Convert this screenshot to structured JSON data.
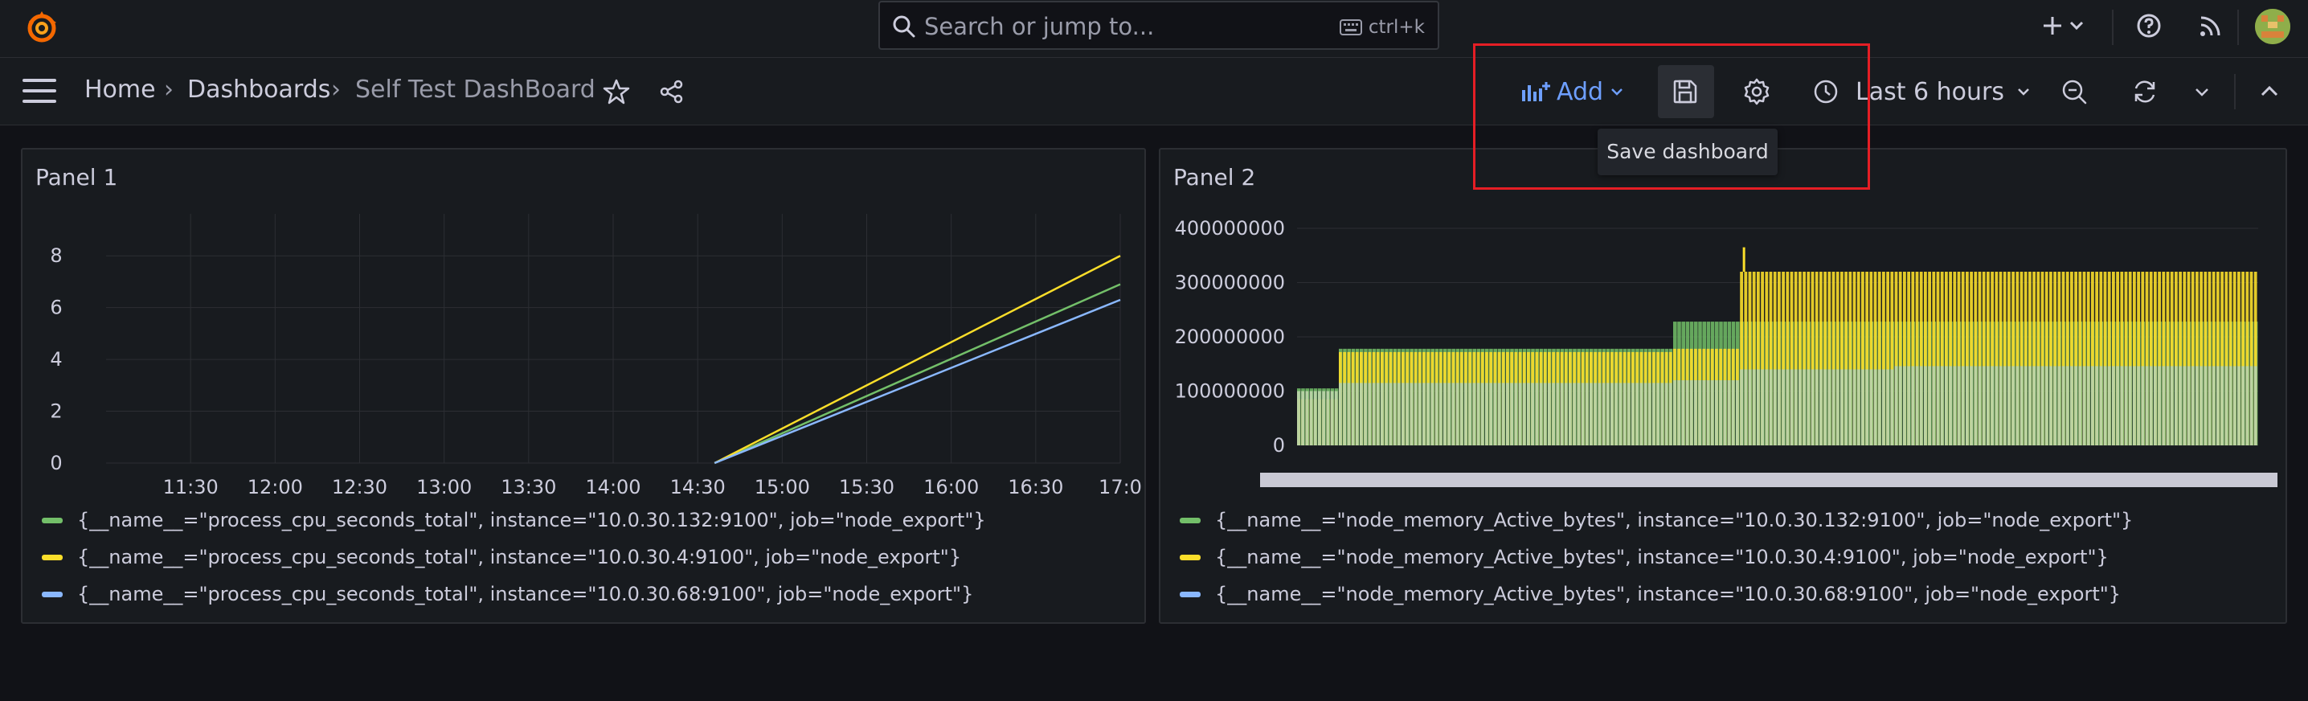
{
  "colors": {
    "series_green": "#73bf69",
    "series_yellow": "#fade2a",
    "series_blue": "#8ab8ff",
    "accent_blue": "#6e9fff",
    "highlight_red": "#e51e25"
  },
  "topbar": {
    "search_placeholder": "Search or jump to...",
    "search_shortcut": "ctrl+k",
    "icons": [
      "grafana-logo-icon",
      "search-icon",
      "keyboard-icon",
      "plus-icon",
      "chevron-down-icon",
      "help-icon",
      "rss-icon",
      "avatar"
    ]
  },
  "navbar": {
    "breadcrumb": [
      "Home",
      "Dashboards",
      "Self Test DashBoard"
    ],
    "separator": "›",
    "add_label": "Add",
    "time_range": "Last 6 hours",
    "tooltip": "Save dashboard"
  },
  "panel1": {
    "title": "Panel 1",
    "legend": [
      "{__name__=\"process_cpu_seconds_total\", instance=\"10.0.30.132:9100\", job=\"node_export\"}",
      "{__name__=\"process_cpu_seconds_total\", instance=\"10.0.30.4:9100\", job=\"node_export\"}",
      "{__name__=\"process_cpu_seconds_total\", instance=\"10.0.30.68:9100\", job=\"node_export\"}"
    ]
  },
  "panel2": {
    "title": "Panel 2",
    "legend": [
      "{__name__=\"node_memory_Active_bytes\", instance=\"10.0.30.132:9100\", job=\"node_export\"}",
      "{__name__=\"node_memory_Active_bytes\", instance=\"10.0.30.4:9100\", job=\"node_export\"}",
      "{__name__=\"node_memory_Active_bytes\", instance=\"10.0.30.68:9100\", job=\"node_export\"}"
    ]
  },
  "chart_data": [
    {
      "type": "line",
      "x_ticks": [
        "11:30",
        "12:00",
        "12:30",
        "13:00",
        "13:30",
        "14:00",
        "14:30",
        "15:00",
        "15:30",
        "16:00",
        "16:30",
        "17:0"
      ],
      "y_ticks": [
        "0",
        "2",
        "4",
        "6",
        "8"
      ],
      "ylim": [
        0,
        9
      ],
      "grid": true,
      "legend_position": "bottom",
      "series": [
        {
          "color": "#73bf69",
          "x": [
            "14:36",
            "17:00"
          ],
          "values": [
            0,
            6.9
          ]
        },
        {
          "color": "#fade2a",
          "x": [
            "14:36",
            "17:00"
          ],
          "values": [
            0,
            8.0
          ]
        },
        {
          "color": "#8ab8ff",
          "x": [
            "14:36",
            "17:00"
          ],
          "values": [
            0,
            6.3
          ]
        }
      ]
    },
    {
      "type": "bar",
      "y_ticks": [
        "0",
        "100000000",
        "200000000",
        "300000000",
        "400000000"
      ],
      "ylim": [
        0,
        400000000
      ],
      "grid": true,
      "legend_position": "bottom",
      "series": [
        {
          "color": "#73bf69",
          "values_approx": [
            105000000,
            178000000,
            228000000,
            228000000
          ]
        },
        {
          "color": "#fade2a",
          "values_approx": [
            85000000,
            172000000,
            178000000,
            320000000
          ]
        },
        {
          "color": "#8ab8ff",
          "values_approx": [
            100000000,
            115000000,
            120000000,
            140000000
          ]
        }
      ]
    }
  ]
}
